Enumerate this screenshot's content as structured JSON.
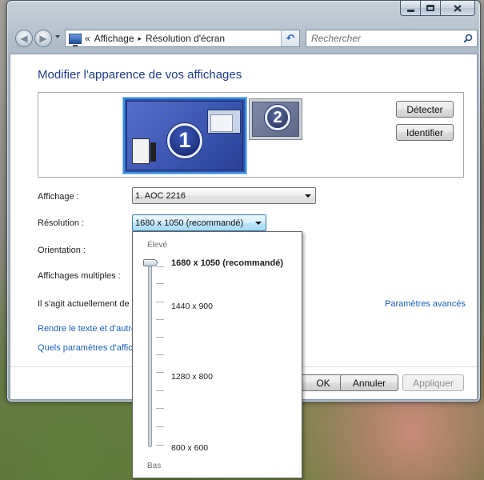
{
  "address_bar": {
    "prefix": "«",
    "crumbs": [
      "Affichage",
      "Résolution d'écran"
    ],
    "separator": "▸"
  },
  "search": {
    "placeholder": "Rechercher"
  },
  "page": {
    "title": "Modifier l'apparence de vos affichages"
  },
  "monitors": [
    {
      "number": "1",
      "selected": true
    },
    {
      "number": "2",
      "selected": false
    }
  ],
  "buttons": {
    "detect": "Détecter",
    "identify": "Identifier",
    "ok": "OK",
    "cancel": "Annuler",
    "apply": "Appliquer"
  },
  "form": {
    "display_label": "Affichage :",
    "display_value": "1. AOC 2216",
    "resolution_label": "Résolution :",
    "resolution_value": "1680 x 1050 (recommandé)",
    "orientation_label": "Orientation :",
    "multiple_label": "Affichages multiples :",
    "current_text": "Il s'agit actuellement de",
    "advanced_link": "Paramètres avancés"
  },
  "links": {
    "text_size": "Rendre le texte et d'autres",
    "which_settings": "Quels paramètres d'affichage"
  },
  "resolution_popup": {
    "high_label": "Élevé",
    "low_label": "Bas",
    "options": [
      {
        "label": "1680 x 1050 (recommandé)",
        "selected": true
      },
      {
        "label": "1440 x 900",
        "selected": false
      },
      {
        "label": "1280 x 800",
        "selected": false
      },
      {
        "label": "800 x 600",
        "selected": false
      }
    ]
  },
  "icons": {
    "minimize": "minimize-icon",
    "maximize": "maximize-icon",
    "close": "close-icon",
    "back": "back-arrow-icon",
    "forward": "forward-arrow-icon",
    "refresh": "refresh-icon",
    "search": "search-icon",
    "control_panel": "display-control-panel-icon"
  }
}
